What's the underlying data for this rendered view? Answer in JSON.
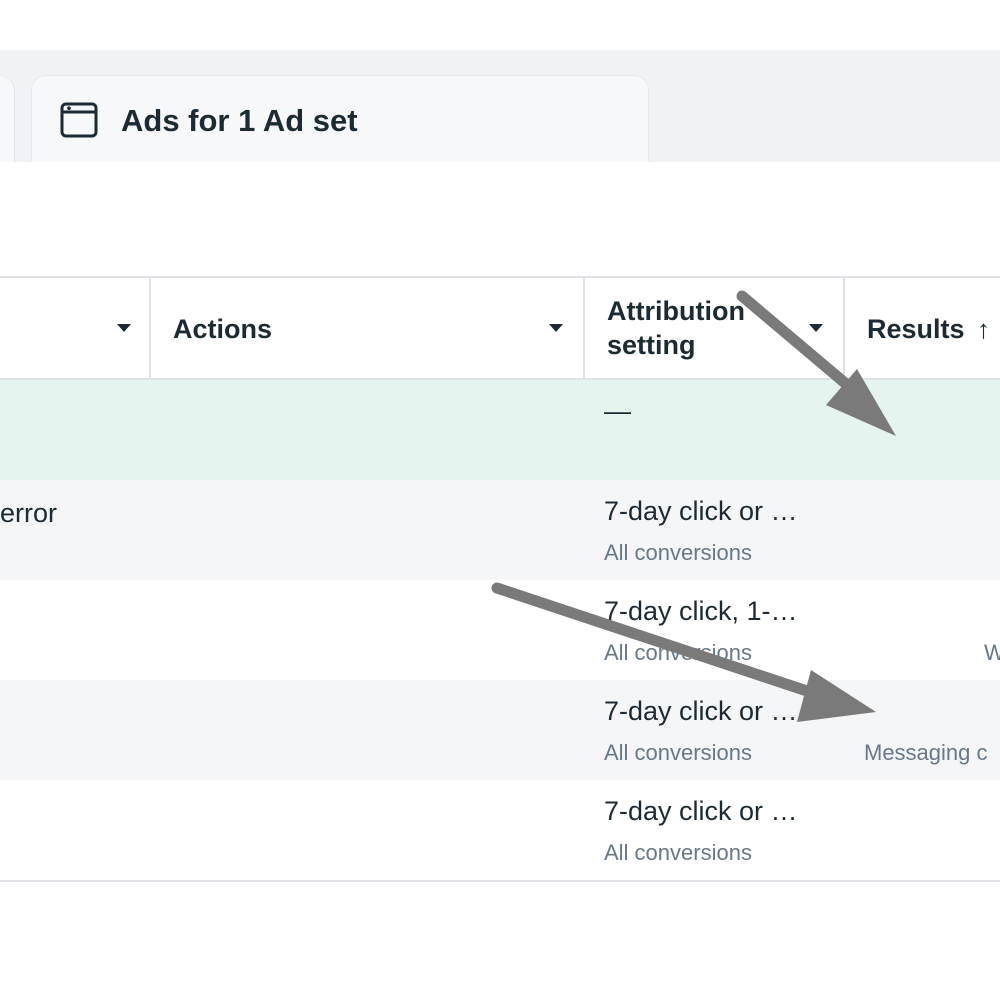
{
  "tabs": {
    "active_label": "Ads for 1 Ad set"
  },
  "table": {
    "columns": [
      {
        "label": ""
      },
      {
        "label": "Actions"
      },
      {
        "label": "Attribution setting"
      },
      {
        "label": "Results"
      }
    ],
    "sort_indicator": "↑",
    "rows": [
      {
        "name": "",
        "attribution": "—",
        "attribution_sub": "",
        "result_sub": ""
      },
      {
        "name": "error",
        "attribution": "7-day click or …",
        "attribution_sub": "All conversions",
        "result_sub": ""
      },
      {
        "name": "",
        "attribution": "7-day click, 1-…",
        "attribution_sub": "All conversions",
        "result_sub": "W"
      },
      {
        "name": "",
        "attribution": "7-day click or …",
        "attribution_sub": "All conversions",
        "result_sub": "Messaging c"
      },
      {
        "name": "",
        "attribution": "7-day click or …",
        "attribution_sub": "All conversions",
        "result_sub": ""
      }
    ]
  },
  "annotations": {
    "arrow_color": "#7a7a7a"
  },
  "colors": {
    "summary_row_bg": "#e6f4ef",
    "striped_row_bg": "#f5f6f7",
    "tab_bar_bg": "#f0f2f5",
    "text_primary": "#1c2b33",
    "text_secondary": "#67788a"
  }
}
